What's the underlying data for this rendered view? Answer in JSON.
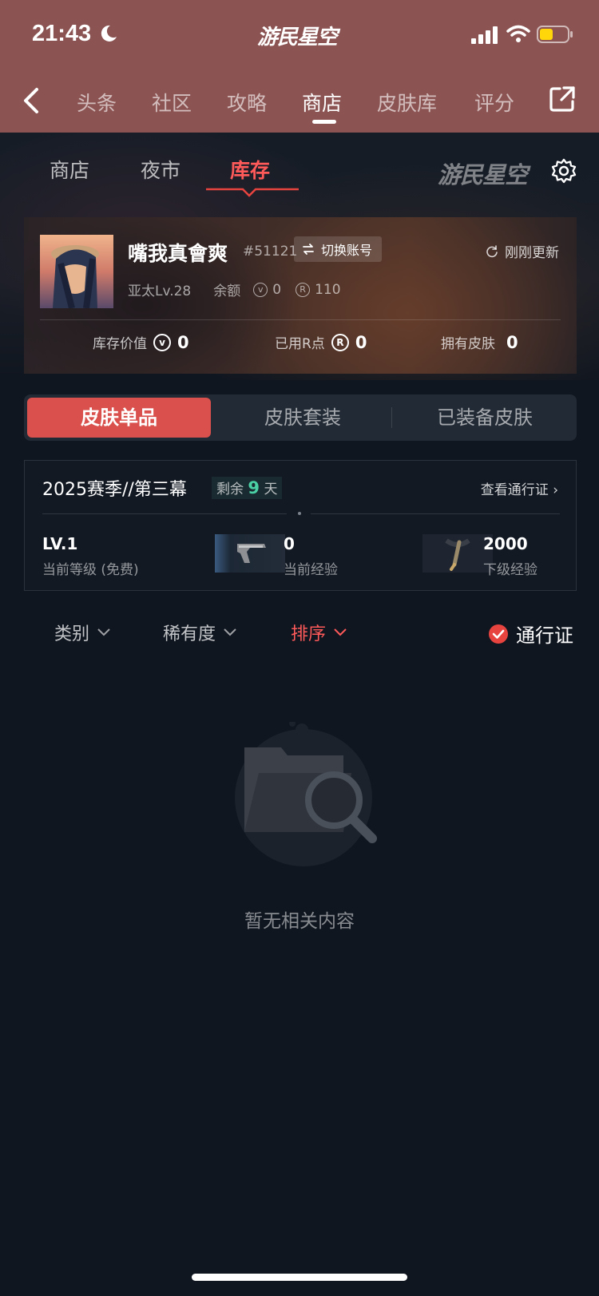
{
  "status_bar": {
    "time": "21:43"
  },
  "header": {
    "brand": "游民星空",
    "tabs": [
      {
        "label": "头条"
      },
      {
        "label": "社区"
      },
      {
        "label": "攻略"
      },
      {
        "label": "商店",
        "active": true
      },
      {
        "label": "皮肤库"
      },
      {
        "label": "评分"
      }
    ]
  },
  "sub_tabs": [
    {
      "label": "商店"
    },
    {
      "label": "夜市"
    },
    {
      "label": "库存",
      "active": true
    }
  ],
  "sub_brand": "游民星空",
  "profile": {
    "name": "嘴我真會爽",
    "tag": "#51121",
    "switch_label": "切换账号",
    "refresh_label": "刚刚更新",
    "region_level": "亚太Lv.28",
    "balance_label": "余额",
    "vp_balance": "0",
    "rp_balance": "110",
    "stats": {
      "inventory_value_label": "库存价值",
      "inventory_value": "0",
      "used_rp_label": "已用R点",
      "used_rp": "0",
      "owned_skins_label": "拥有皮肤",
      "owned_skins": "0"
    }
  },
  "segments": [
    {
      "label": "皮肤单品",
      "active": true
    },
    {
      "label": "皮肤套装"
    },
    {
      "label": "已装备皮肤"
    }
  ],
  "season": {
    "title": "2025赛季//第三幕",
    "remain_prefix": "剩余",
    "remain_days": "9",
    "remain_suffix": "天",
    "view_pass": "查看通行证",
    "level_value": "LV.1",
    "level_label": "当前等级 (免费)",
    "exp_value": "0",
    "exp_label": "当前经验",
    "next_value": "2000",
    "next_label": "下级经验"
  },
  "filters": {
    "category": "类别",
    "rarity": "稀有度",
    "sort": "排序",
    "pass": "通行证"
  },
  "empty_state": {
    "text": "暂无相关内容"
  },
  "colors": {
    "header_bg": "#8b5352",
    "accent_red": "#d9504c",
    "accent_green": "#4ad0a4",
    "page_bg": "#0f1620"
  }
}
